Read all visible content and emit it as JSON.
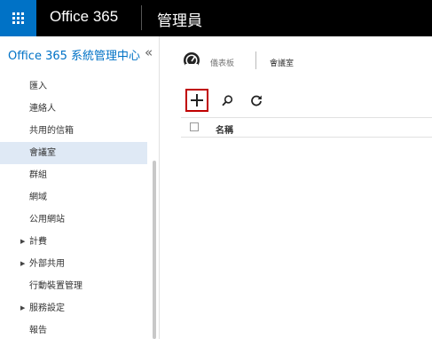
{
  "header": {
    "brand": "Office 365",
    "app_title": "管理員"
  },
  "sidebar": {
    "title": "Office 365 系統管理中心",
    "collapse_glyph": "«",
    "items": [
      {
        "label": "匯入"
      },
      {
        "label": "連絡人"
      },
      {
        "label": "共用的信箱"
      },
      {
        "label": "會議室",
        "active": true
      },
      {
        "label": "群組"
      },
      {
        "label": "網域"
      },
      {
        "label": "公用網站"
      },
      {
        "label": "計費",
        "expandable": true
      },
      {
        "label": "外部共用",
        "expandable": true
      },
      {
        "label": "行動裝置管理"
      },
      {
        "label": "服務設定",
        "expandable": true
      },
      {
        "label": "報告"
      }
    ]
  },
  "breadcrumb": {
    "dashboard": "儀表板",
    "current": "會議室"
  },
  "toolbar": {
    "icons": [
      "plus-icon",
      "search-icon",
      "refresh-icon"
    ]
  },
  "table": {
    "columns": [
      "名稱"
    ]
  },
  "colors": {
    "launcher": "#0072c6",
    "accent": "#0072c6",
    "active_item": "#dfe9f5",
    "highlight_border": "#c00000"
  }
}
